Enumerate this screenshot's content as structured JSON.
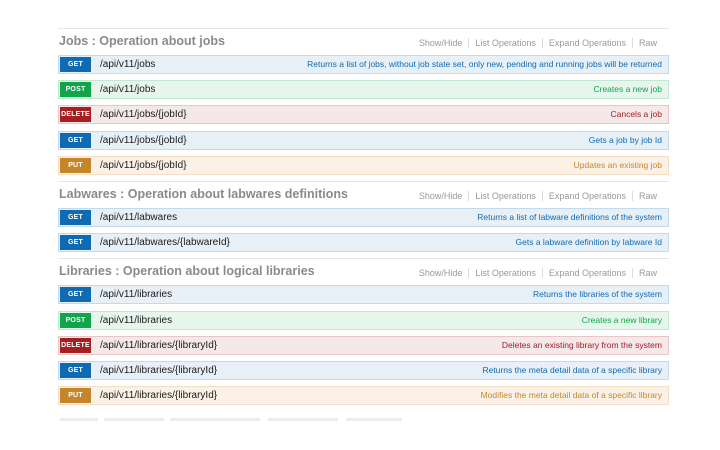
{
  "sections": [
    {
      "title": "Jobs : Operation about jobs",
      "actions": [
        "Show/Hide",
        "List Operations",
        "Expand Operations",
        "Raw"
      ],
      "operations": [
        {
          "method": "get",
          "verb": "GET",
          "path": "/api/v11/jobs",
          "summary": "Returns a list of jobs, without job state set, only new, pending and running jobs will be returned"
        },
        {
          "method": "post",
          "verb": "POST",
          "path": "/api/v11/jobs",
          "summary": "Creates a new job"
        },
        {
          "method": "delete",
          "verb": "DELETE",
          "path": "/api/v11/jobs/{jobId}",
          "summary": "Cancels a job"
        },
        {
          "method": "get",
          "verb": "GET",
          "path": "/api/v11/jobs/{jobId}",
          "summary": "Gets a job by job Id"
        },
        {
          "method": "put",
          "verb": "PUT",
          "path": "/api/v11/jobs/{jobId}",
          "summary": "Updates an existing job"
        }
      ]
    },
    {
      "title": "Labwares : Operation about labwares definitions",
      "actions": [
        "Show/Hide",
        "List Operations",
        "Expand Operations",
        "Raw"
      ],
      "operations": [
        {
          "method": "get",
          "verb": "GET",
          "path": "/api/v11/labwares",
          "summary": "Returns a list of labware definitions of the system"
        },
        {
          "method": "get",
          "verb": "GET",
          "path": "/api/v11/labwares/{labwareId}",
          "summary": "Gets a labware definition by labware Id"
        }
      ]
    },
    {
      "title": "Libraries : Operation about logical libraries",
      "actions": [
        "Show/Hide",
        "List Operations",
        "Expand Operations",
        "Raw"
      ],
      "operations": [
        {
          "method": "get",
          "verb": "GET",
          "path": "/api/v11/libraries",
          "summary": "Returns the libraries of the system"
        },
        {
          "method": "post",
          "verb": "POST",
          "path": "/api/v11/libraries",
          "summary": "Creates a new library"
        },
        {
          "method": "delete",
          "verb": "DELETE",
          "path": "/api/v11/libraries/{libraryId}",
          "summary": "Deletes an existing library from the system"
        },
        {
          "method": "get",
          "verb": "GET",
          "path": "/api/v11/libraries/{libraryId}",
          "summary": "Returns the meta detail data of a specific library"
        },
        {
          "method": "put",
          "verb": "PUT",
          "path": "/api/v11/libraries/{libraryId}",
          "summary": "Modifies the meta detail data of a specific library"
        }
      ]
    }
  ],
  "colors": {
    "get": "#0f6ab4",
    "post": "#10a54a",
    "delete": "#a41e22",
    "put": "#c5862b"
  }
}
